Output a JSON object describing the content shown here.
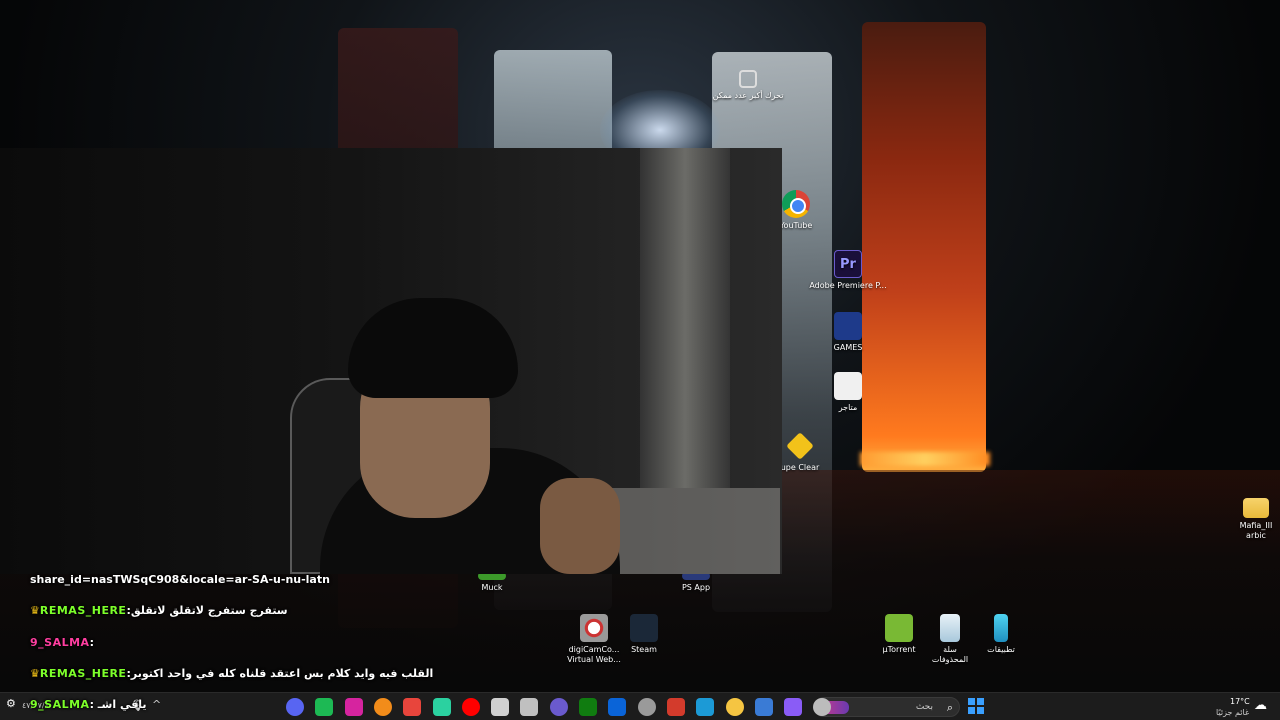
{
  "desktop": {
    "icons": [
      {
        "label": "تحرك أكبر عدد ممكن",
        "icon": "controller-icon"
      },
      {
        "label": "YouTube",
        "icon": "chrome-icon"
      },
      {
        "label": "Adobe Premiere P...",
        "icon": "premiere-icon"
      },
      {
        "label": "GAMES",
        "icon": "games-icon"
      },
      {
        "label": "متاجر",
        "icon": "store-icon"
      },
      {
        "label": "upe Clear",
        "icon": "clear-icon"
      },
      {
        "label": "Mafia_III arbic",
        "icon": "folder-icon"
      },
      {
        "label": "Muck",
        "icon": "muck-icon"
      },
      {
        "label": "PS App",
        "icon": "ps-icon"
      },
      {
        "label": "digiCamCo... Virtual Web...",
        "icon": "webcam-icon"
      },
      {
        "label": "Steam",
        "icon": "steam-icon"
      },
      {
        "label": "µTorrent",
        "icon": "utorrent-icon"
      },
      {
        "label": "سلة المحذوفات",
        "icon": "recycle-bin-icon"
      },
      {
        "label": "تطبيقات",
        "icon": "apps-icon"
      }
    ]
  },
  "chat": {
    "share_line": "share_id=nasTWSqC908&locale=ar-SA-u-nu-latn",
    "messages": [
      {
        "user": "REMAS_HERE",
        "text": "ستفرج ستفرج لاتقلق لاتقلق",
        "badge": "♛"
      },
      {
        "user": "9_SALMA",
        "text": "",
        "badge": ""
      },
      {
        "user": "REMAS_HERE",
        "text": "القلب فيه وايد كلام بس اعتقد قلناه كله في واحد اكتوبر",
        "badge": "♛"
      }
    ]
  },
  "taskbar": {
    "now_playing_user": "9_SALMA",
    "now_playing_text": "يافي اشـ",
    "time_small": "٤٧/٠٧/٨",
    "search_placeholder": "بحث",
    "weather_temp": "17°C",
    "weather_desc": "غائم جزئيًا",
    "pinned_apps": [
      {
        "name": "discord-icon",
        "color": "#5865f2"
      },
      {
        "name": "spotify-icon",
        "color": "#1db954"
      },
      {
        "name": "instagram-icon",
        "color": "#d6249f"
      },
      {
        "name": "vlc-icon",
        "color": "#f28c1a"
      },
      {
        "name": "chrome-icon",
        "color": "#e8453c"
      },
      {
        "name": "capcut-icon",
        "color": "#2bd1a0"
      },
      {
        "name": "youtube-icon",
        "color": "#ff0000"
      },
      {
        "name": "obs-icon",
        "color": "#d0d0d0"
      },
      {
        "name": "clock-icon",
        "color": "#c0c0c0"
      },
      {
        "name": "movies-icon",
        "color": "#6a5acd"
      },
      {
        "name": "xbox-icon",
        "color": "#107c10"
      },
      {
        "name": "outlook-icon",
        "color": "#0a64d8"
      },
      {
        "name": "unity-icon",
        "color": "#9a9a9a"
      },
      {
        "name": "app-red-icon",
        "color": "#d33b2c"
      },
      {
        "name": "edge-icon",
        "color": "#1c9ad6"
      },
      {
        "name": "explorer-icon",
        "color": "#f5c542"
      },
      {
        "name": "store-icon",
        "color": "#3a7bd5"
      },
      {
        "name": "copilot-icon",
        "color": "#8a5cf6"
      },
      {
        "name": "window-icon",
        "color": "#bcbcbc"
      }
    ]
  }
}
